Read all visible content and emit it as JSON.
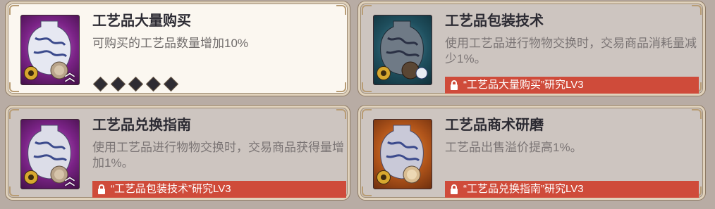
{
  "cards": [
    {
      "title": "工艺品大量购买",
      "desc": "可购买的工艺品数量增加10%",
      "state": "active",
      "level": 5
    },
    {
      "title": "工艺品包装技术",
      "desc": "使用工艺品进行物物交换时，交易商品消耗量减少1%。",
      "state": "locked",
      "requirement": "“工艺品大量购买”研究LV3"
    },
    {
      "title": "工艺品兑换指南",
      "desc": "使用工艺品进行物物交换时，交易商品获得量增加1%。",
      "state": "locked",
      "requirement": "“工艺品包装技术”研究LV3"
    },
    {
      "title": "工艺品商术研磨",
      "desc": "工艺品出售溢价提高1%。",
      "state": "locked",
      "requirement": "“工艺品兑换指南”研究LV3"
    }
  ],
  "colors": {
    "requirement_bar": "#cf4b3a",
    "active_bg": "#fbf7f0",
    "locked_bg": "#cdc5c0"
  }
}
